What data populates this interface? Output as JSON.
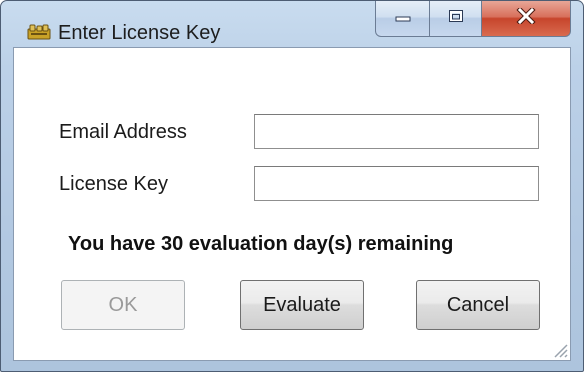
{
  "window": {
    "title": "Enter License Key",
    "icon": "keys-icon"
  },
  "caption": {
    "minimize_icon": "minimize-icon",
    "maximize_icon": "maximize-icon",
    "close_icon": "close-icon",
    "close_color": "#c7452c"
  },
  "form": {
    "email_label": "Email Address",
    "email_value": "",
    "license_label": "License Key",
    "license_value": ""
  },
  "status": {
    "message": "You have 30 evaluation day(s) remaining"
  },
  "buttons": {
    "ok_label": "OK",
    "ok_enabled": false,
    "evaluate_label": "Evaluate",
    "cancel_label": "Cancel"
  }
}
